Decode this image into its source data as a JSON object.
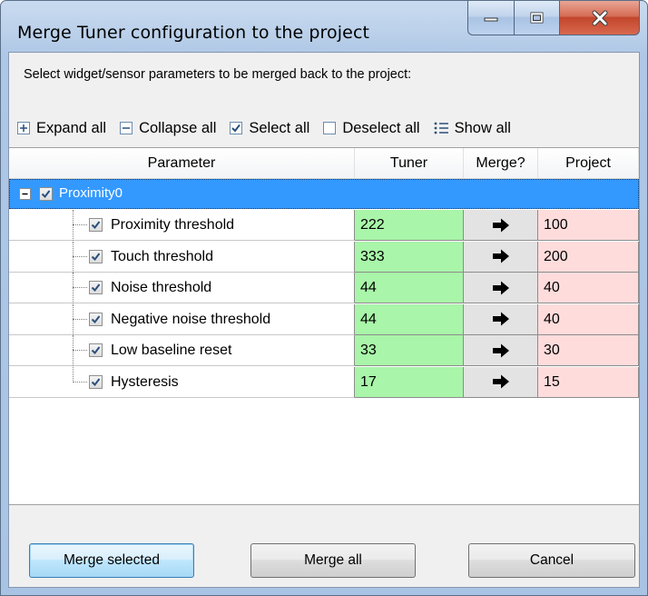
{
  "window": {
    "title": "Merge Tuner configuration to the project"
  },
  "instructions": "Select widget/sensor parameters to be merged back to the project:",
  "toolbar": {
    "expand_all": "Expand all",
    "collapse_all": "Collapse all",
    "select_all": "Select all",
    "deselect_all": "Deselect all",
    "show_all": "Show all"
  },
  "grid": {
    "columns": [
      "Parameter",
      "Tuner",
      "Merge?",
      "Project"
    ],
    "parent": {
      "label": "Proximity0",
      "checked": true,
      "expanded": true
    },
    "rows": [
      {
        "param": "Proximity threshold",
        "tuner": "222",
        "project": "100",
        "checked": true
      },
      {
        "param": "Touch threshold",
        "tuner": "333",
        "project": "200",
        "checked": true
      },
      {
        "param": "Noise threshold",
        "tuner": "44",
        "project": "40",
        "checked": true
      },
      {
        "param": "Negative noise threshold",
        "tuner": "44",
        "project": "40",
        "checked": true
      },
      {
        "param": "Low baseline reset",
        "tuner": "33",
        "project": "30",
        "checked": true
      },
      {
        "param": "Hysteresis",
        "tuner": "17",
        "project": "15",
        "checked": true
      }
    ]
  },
  "buttons": {
    "merge_selected": "Merge selected",
    "merge_all": "Merge all",
    "cancel": "Cancel"
  },
  "icons": {
    "expand": "expand-icon",
    "collapse": "collapse-icon",
    "checkbox": "checkbox-checked-icon",
    "checkbox_empty": "checkbox-empty-icon",
    "list": "list-icon",
    "arrow": "arrow-right-icon"
  },
  "colors": {
    "selection": "#3399ff",
    "tuner_cell": "#a9f5a9",
    "project_cell": "#ffdcdc",
    "merge_cell": "#e3e3e3"
  }
}
